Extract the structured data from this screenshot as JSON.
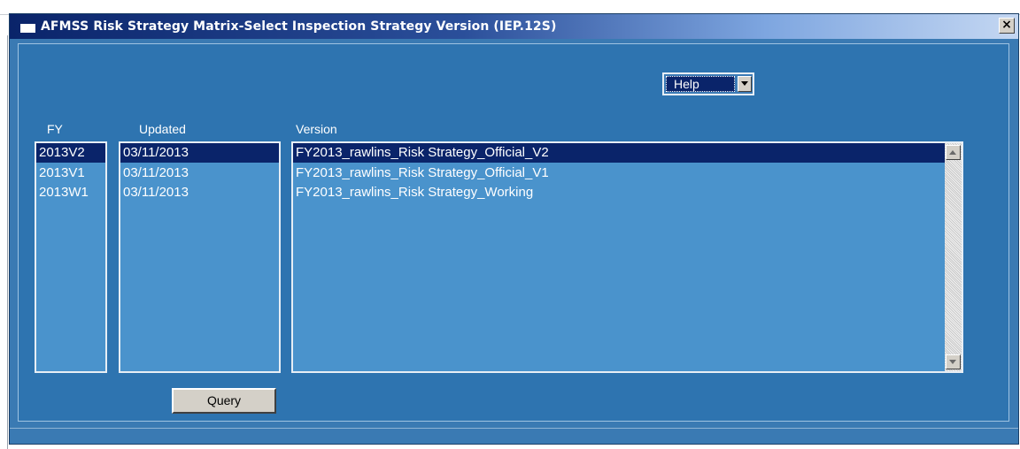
{
  "window": {
    "title": "AFMSS Risk Strategy Matrix-Select Inspection Strategy Version (IEP.12S)",
    "close_label": "×"
  },
  "help": {
    "selected": "Help"
  },
  "columns": {
    "fy": "FY",
    "updated": "Updated",
    "version": "Version"
  },
  "fy_list": [
    "2013V2",
    "2013V1",
    "2013W1"
  ],
  "updated_list": [
    "03/11/2013",
    "03/11/2013",
    "03/11/2013"
  ],
  "version_list": [
    "FY2013_rawlins_Risk Strategy_Official_V2",
    "FY2013_rawlins_Risk Strategy_Official_V1",
    "FY2013_rawlins_Risk Strategy_Working"
  ],
  "selected_index": 0,
  "query_label": "Query",
  "colors": {
    "window_bg": "#3a7ab3",
    "list_bg": "#4a93cc",
    "selection": "#0a246a",
    "titlebar_start": "#0a246a"
  },
  "icons": {
    "title": "window-icon",
    "close": "close-icon",
    "dropdown": "chevron-down-icon",
    "scroll_up": "scroll-up-arrow-icon",
    "scroll_down": "scroll-down-arrow-icon"
  }
}
